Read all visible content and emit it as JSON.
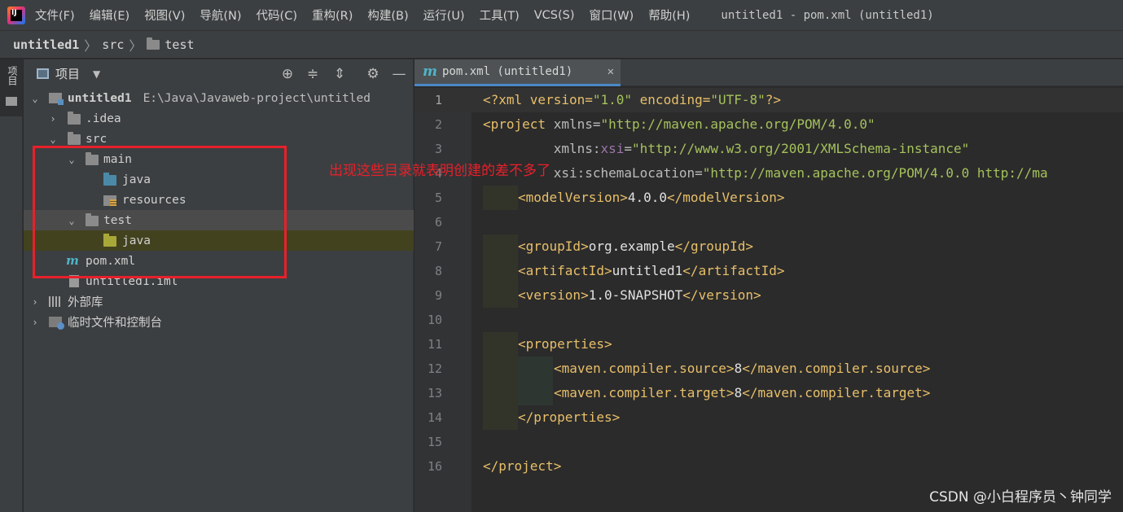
{
  "menu": {
    "items": [
      "文件(F)",
      "编辑(E)",
      "视图(V)",
      "导航(N)",
      "代码(C)",
      "重构(R)",
      "构建(B)",
      "运行(U)",
      "工具(T)",
      "VCS(S)",
      "窗口(W)",
      "帮助(H)"
    ],
    "window_title": "untitled1 - pom.xml (untitled1)"
  },
  "breadcrumb": [
    "untitled1",
    "src",
    "test"
  ],
  "toolstrip": {
    "tab_label": "项目"
  },
  "project_panel": {
    "title": "项目",
    "tree": {
      "root_label": "untitled1",
      "root_path": "E:\\Java\\Javaweb-project\\untitled",
      "idea": ".idea",
      "src": "src",
      "main": "main",
      "main_java": "java",
      "resources": "resources",
      "test": "test",
      "test_java": "java",
      "pom": "pom.xml",
      "iml": "untitled1.iml",
      "external_libs": "外部库",
      "scratches": "临时文件和控制台"
    }
  },
  "annotation": {
    "text": "出现这些目录就表明创建的差不多了"
  },
  "editor": {
    "tab_label": "pom.xml (untitled1)",
    "line_numbers": [
      "1",
      "2",
      "3",
      "4",
      "5",
      "6",
      "7",
      "8",
      "9",
      "10",
      "11",
      "12",
      "13",
      "14",
      "15",
      "16"
    ],
    "code": {
      "l1_a": "<?xml version=",
      "l1_b": "\"1.0\"",
      "l1_c": " encoding=",
      "l1_d": "\"UTF-8\"",
      "l1_e": "?>",
      "l2_a": "<project ",
      "l2_b": "xmlns=",
      "l2_c": "\"http://maven.apache.org/POM/4.0.0\"",
      "l3_a": "         xmlns:",
      "l3_b": "xsi",
      "l3_c": "=",
      "l3_d": "\"http://www.w3.org/2001/XMLSchema-instance\"",
      "l4_a": "         xsi:",
      "l4_b": "schemaLocation=",
      "l4_c": "\"http://maven.apache.org/POM/4.0.0 http://ma",
      "l5_open": "<modelVersion>",
      "l5_val": "4.0.0",
      "l5_close": "</modelVersion>",
      "l7_open": "<groupId>",
      "l7_val": "org.example",
      "l7_close": "</groupId>",
      "l8_open": "<artifactId>",
      "l8_val": "untitled1",
      "l8_close": "</artifactId>",
      "l9_open": "<version>",
      "l9_val": "1.0-SNAPSHOT",
      "l9_close": "</version>",
      "l11": "<properties>",
      "l12_open": "<maven.compiler.source>",
      "l12_val": "8",
      "l12_close": "</maven.compiler.source>",
      "l13_open": "<maven.compiler.target>",
      "l13_val": "8",
      "l13_close": "</maven.compiler.target>",
      "l14": "</properties>",
      "l16": "</project>"
    }
  },
  "watermark": "CSDN @小白程序员丶钟同学",
  "colors": {
    "annotation_red": "#e8202b",
    "tag": "#e8bf6a",
    "string": "#a5c25c",
    "accent_blue": "#4a88c7"
  }
}
